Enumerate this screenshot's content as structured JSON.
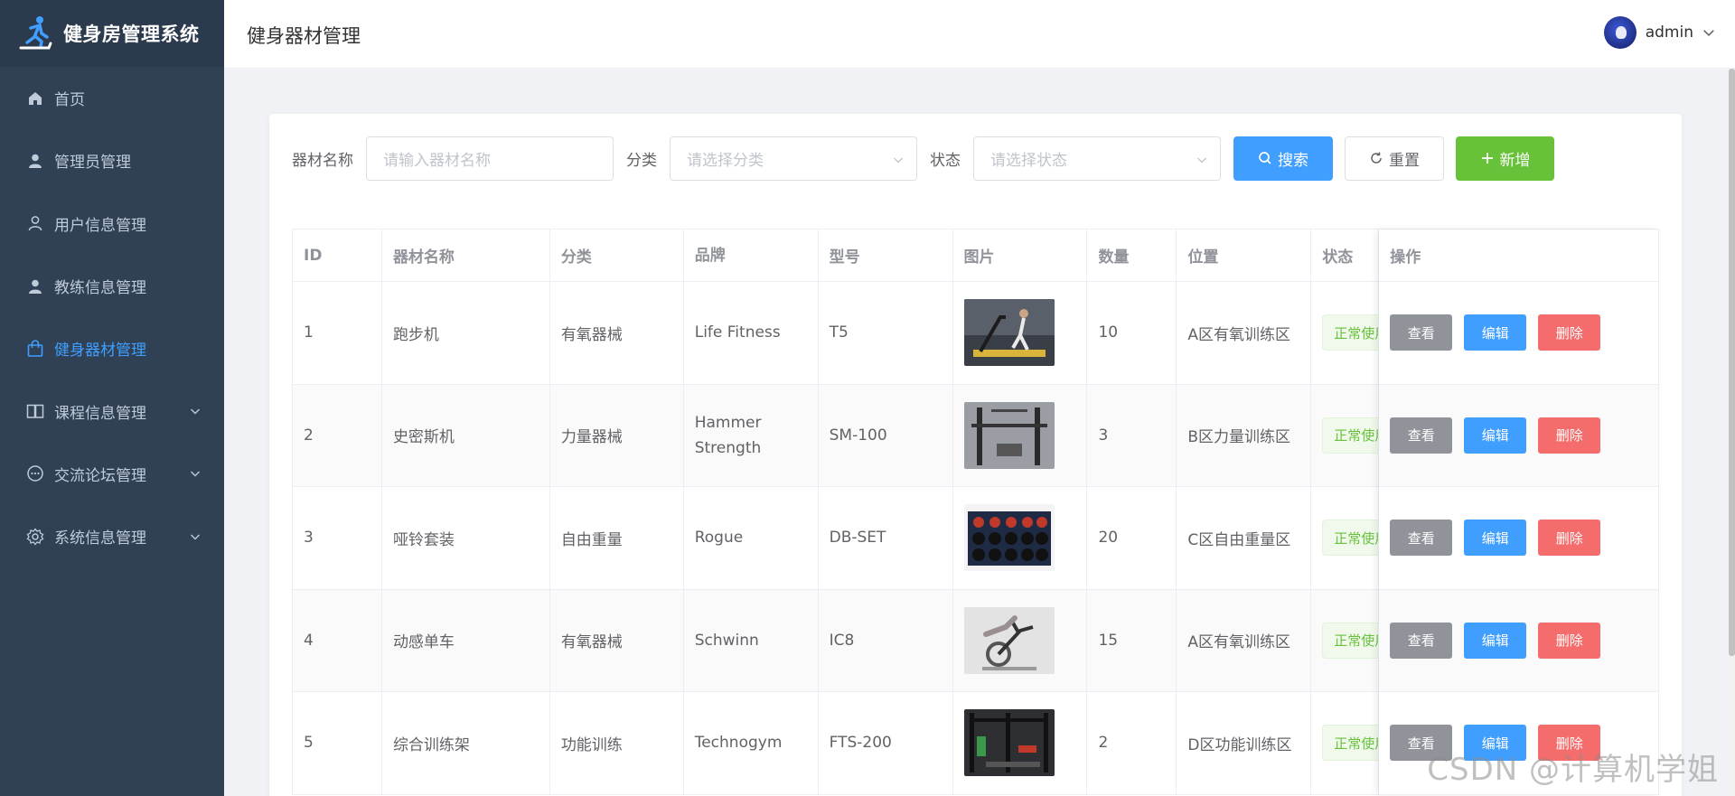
{
  "app": {
    "title": "健身房管理系统"
  },
  "sidebar": {
    "items": [
      {
        "label": "首页",
        "icon": "home-icon",
        "active": false,
        "has_children": false
      },
      {
        "label": "管理员管理",
        "icon": "user-icon",
        "active": false,
        "has_children": false
      },
      {
        "label": "用户信息管理",
        "icon": "user-outline-icon",
        "active": false,
        "has_children": false
      },
      {
        "label": "教练信息管理",
        "icon": "user-icon",
        "active": false,
        "has_children": false
      },
      {
        "label": "健身器材管理",
        "icon": "shopping-bag-icon",
        "active": true,
        "has_children": false
      },
      {
        "label": "课程信息管理",
        "icon": "book-icon",
        "active": false,
        "has_children": true
      },
      {
        "label": "交流论坛管理",
        "icon": "chat-icon",
        "active": false,
        "has_children": true
      },
      {
        "label": "系统信息管理",
        "icon": "gear-icon",
        "active": false,
        "has_children": true
      }
    ]
  },
  "header": {
    "title": "健身器材管理",
    "user": "admin"
  },
  "filters": {
    "name_label": "器材名称",
    "name_placeholder": "请输入器材名称",
    "category_label": "分类",
    "category_placeholder": "请选择分类",
    "status_label": "状态",
    "status_placeholder": "请选择状态",
    "search_button": "搜索",
    "reset_button": "重置",
    "add_button": "新增"
  },
  "table": {
    "columns": [
      "ID",
      "器材名称",
      "分类",
      "品牌",
      "型号",
      "图片",
      "数量",
      "位置",
      "状态",
      "操作"
    ],
    "rows": [
      {
        "id": "1",
        "name": "跑步机",
        "category": "有氧器械",
        "brand": "Life Fitness",
        "model": "T5",
        "image": "treadmill",
        "qty": "10",
        "position": "A区有氧训练区",
        "status": "正常使用"
      },
      {
        "id": "2",
        "name": "史密斯机",
        "category": "力量器械",
        "brand": "Hammer Strength",
        "model": "SM-100",
        "image": "smith-machine",
        "qty": "3",
        "position": "B区力量训练区",
        "status": "正常使用"
      },
      {
        "id": "3",
        "name": "哑铃套装",
        "category": "自由重量",
        "brand": "Rogue",
        "model": "DB-SET",
        "image": "dumbbell-rack",
        "qty": "20",
        "position": "C区自由重量区",
        "status": "正常使用"
      },
      {
        "id": "4",
        "name": "动感单车",
        "category": "有氧器械",
        "brand": "Schwinn",
        "model": "IC8",
        "image": "spin-bike",
        "qty": "15",
        "position": "A区有氧训练区",
        "status": "正常使用"
      },
      {
        "id": "5",
        "name": "综合训练架",
        "category": "功能训练",
        "brand": "Technogym",
        "model": "FTS-200",
        "image": "training-rack",
        "qty": "2",
        "position": "D区功能训练区",
        "status": "正常使用"
      }
    ],
    "actions": {
      "view": "查看",
      "edit": "编辑",
      "delete": "删除"
    }
  },
  "watermark": "CSDN @计算机学姐",
  "colors": {
    "sidebar": "#304156",
    "primary": "#409eff",
    "success": "#67c23a",
    "danger": "#f56c6c",
    "info": "#909399"
  }
}
